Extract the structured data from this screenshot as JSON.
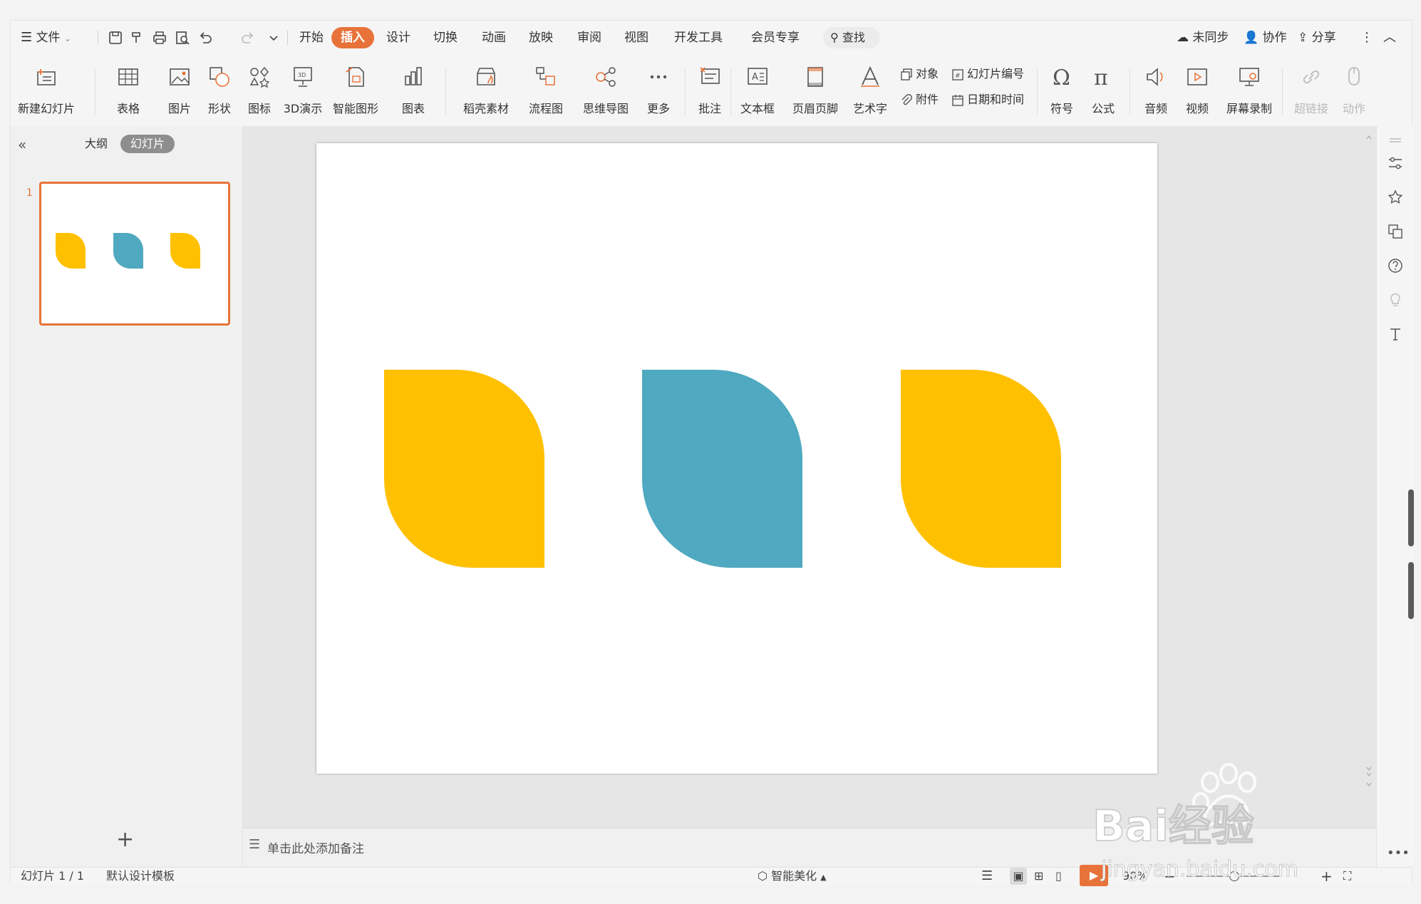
{
  "menubar": {
    "file_label": "文件",
    "tabs": [
      "开始",
      "插入",
      "设计",
      "切换",
      "动画",
      "放映",
      "审阅",
      "视图",
      "开发工具",
      "会员专享"
    ],
    "active_tab": "插入",
    "search_label": "查找",
    "right": {
      "sync": "未同步",
      "collab": "协作",
      "share": "分享"
    }
  },
  "ribbon": {
    "new_slide": "新建幻灯片",
    "table": "表格",
    "picture": "图片",
    "shape": "形状",
    "icon": "图标",
    "demo3d": "3D演示",
    "smartart": "智能图形",
    "chart": "图表",
    "docer": "稻壳素材",
    "flowchart": "流程图",
    "mindmap": "思维导图",
    "more": "更多",
    "comment": "批注",
    "textbox": "文本框",
    "headerfooter": "页眉页脚",
    "wordart": "艺术字",
    "object": "对象",
    "slide_number": "幻灯片编号",
    "attachment": "附件",
    "datetime": "日期和时间",
    "symbol": "符号",
    "formula": "公式",
    "audio": "音频",
    "video": "视频",
    "screen_record": "屏幕录制",
    "hyperlink": "超链接",
    "action": "动作"
  },
  "panel": {
    "outline_tab": "大纲",
    "slides_tab": "幻灯片",
    "slide_number": "1"
  },
  "slide": {
    "shape_colors": [
      "#FFC000",
      "#4FA9C0",
      "#FFC000"
    ]
  },
  "notes": {
    "placeholder": "单击此处添加备注"
  },
  "statusbar": {
    "slide_info": "幻灯片 1 / 1",
    "template": "默认设计模板",
    "beautify": "智能美化",
    "zoom": "90%"
  },
  "watermark": {
    "text": "Bai经验",
    "url": "jingyan.baidu.com"
  }
}
